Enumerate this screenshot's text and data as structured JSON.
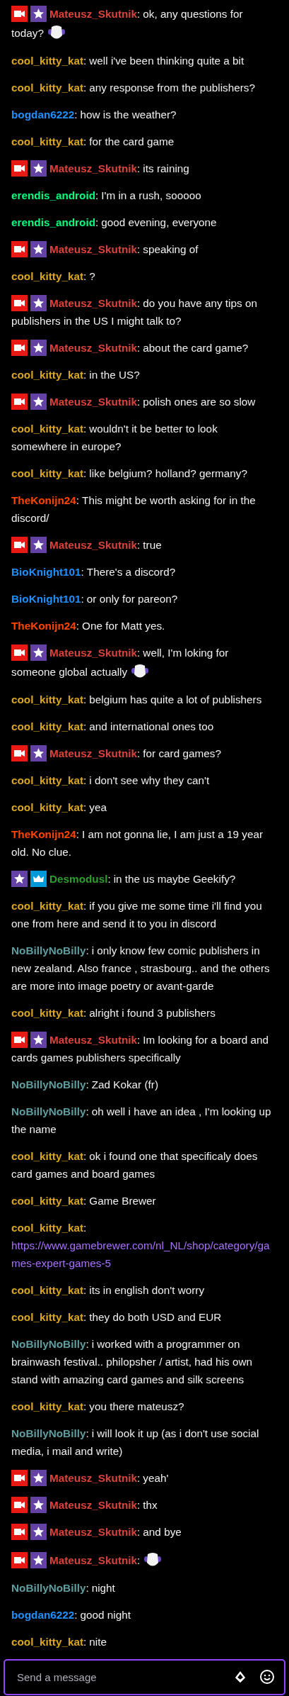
{
  "messages": [
    {
      "badges": [
        {
          "kind": "broadcaster"
        },
        {
          "kind": "subscriber"
        }
      ],
      "user": "Mateusz_Skutnik",
      "color": "#d9433c",
      "separator": ":",
      "parts": [
        {
          "kind": "text",
          "text": "ok, any questions for today?"
        },
        {
          "kind": "emote"
        }
      ]
    },
    {
      "user": "cool_kitty_kat",
      "color": "#daa520",
      "separator": ":",
      "parts": [
        {
          "kind": "text",
          "text": "well i've been thinking quite a bit"
        }
      ]
    },
    {
      "user": "cool_kitty_kat",
      "color": "#daa520",
      "separator": ":",
      "parts": [
        {
          "kind": "text",
          "text": "any response from the publishers?"
        }
      ]
    },
    {
      "user": "bogdan6222",
      "color": "#1e90ff",
      "separator": ":",
      "parts": [
        {
          "kind": "text",
          "text": "how is the weather?"
        }
      ]
    },
    {
      "user": "cool_kitty_kat",
      "color": "#daa520",
      "separator": ":",
      "parts": [
        {
          "kind": "text",
          "text": "for the card game"
        }
      ]
    },
    {
      "badges": [
        {
          "kind": "broadcaster"
        },
        {
          "kind": "subscriber"
        }
      ],
      "user": "Mateusz_Skutnik",
      "color": "#d9433c",
      "separator": ":",
      "parts": [
        {
          "kind": "text",
          "text": "its raining"
        }
      ]
    },
    {
      "user": "erendis_android",
      "color": "#00ff7f",
      "separator": ":",
      "parts": [
        {
          "kind": "text",
          "text": "I'm in a rush, sooooo"
        }
      ]
    },
    {
      "user": "erendis_android",
      "color": "#00ff7f",
      "separator": ":",
      "parts": [
        {
          "kind": "text",
          "text": "good evening, everyone"
        }
      ]
    },
    {
      "badges": [
        {
          "kind": "broadcaster"
        },
        {
          "kind": "subscriber"
        }
      ],
      "user": "Mateusz_Skutnik",
      "color": "#d9433c",
      "separator": ":",
      "parts": [
        {
          "kind": "text",
          "text": "speaking of"
        }
      ]
    },
    {
      "user": "cool_kitty_kat",
      "color": "#daa520",
      "separator": ":",
      "parts": [
        {
          "kind": "text",
          "text": "?"
        }
      ]
    },
    {
      "badges": [
        {
          "kind": "broadcaster"
        },
        {
          "kind": "subscriber"
        }
      ],
      "user": "Mateusz_Skutnik",
      "color": "#d9433c",
      "separator": ":",
      "parts": [
        {
          "kind": "text",
          "text": "do you have any tips on publishers in the US I might talk to?"
        }
      ]
    },
    {
      "badges": [
        {
          "kind": "broadcaster"
        },
        {
          "kind": "subscriber"
        }
      ],
      "user": "Mateusz_Skutnik",
      "color": "#d9433c",
      "separator": ":",
      "parts": [
        {
          "kind": "text",
          "text": "about the card game?"
        }
      ]
    },
    {
      "user": "cool_kitty_kat",
      "color": "#daa520",
      "separator": ":",
      "parts": [
        {
          "kind": "text",
          "text": "in the US?"
        }
      ]
    },
    {
      "badges": [
        {
          "kind": "broadcaster"
        },
        {
          "kind": "subscriber"
        }
      ],
      "user": "Mateusz_Skutnik",
      "color": "#d9433c",
      "separator": ":",
      "parts": [
        {
          "kind": "text",
          "text": "polish ones are so slow"
        }
      ]
    },
    {
      "user": "cool_kitty_kat",
      "color": "#daa520",
      "separator": ":",
      "parts": [
        {
          "kind": "text",
          "text": "wouldn't it be better to look somewhere in europe?"
        }
      ]
    },
    {
      "user": "cool_kitty_kat",
      "color": "#daa520",
      "separator": ":",
      "parts": [
        {
          "kind": "text",
          "text": "like belgium? holland? germany?"
        }
      ]
    },
    {
      "user": "TheKonijn24",
      "color": "#ff4500",
      "separator": ":",
      "parts": [
        {
          "kind": "text",
          "text": "This might be worth asking for in the discord/"
        }
      ]
    },
    {
      "badges": [
        {
          "kind": "broadcaster"
        },
        {
          "kind": "subscriber"
        }
      ],
      "user": "Mateusz_Skutnik",
      "color": "#d9433c",
      "separator": ":",
      "parts": [
        {
          "kind": "text",
          "text": "true"
        }
      ]
    },
    {
      "user": "BioKnight101",
      "color": "#1e90ff",
      "separator": ":",
      "parts": [
        {
          "kind": "text",
          "text": "There's a discord?"
        }
      ]
    },
    {
      "user": "BioKnight101",
      "color": "#1e90ff",
      "separator": ":",
      "parts": [
        {
          "kind": "text",
          "text": "or only for pareon?"
        }
      ]
    },
    {
      "user": "TheKonijn24",
      "color": "#ff4500",
      "separator": ":",
      "parts": [
        {
          "kind": "text",
          "text": "One for Matt yes."
        }
      ]
    },
    {
      "badges": [
        {
          "kind": "broadcaster"
        },
        {
          "kind": "subscriber"
        }
      ],
      "user": "Mateusz_Skutnik",
      "color": "#d9433c",
      "separator": ":",
      "parts": [
        {
          "kind": "text",
          "text": "well, I'm loking for someone global actually"
        },
        {
          "kind": "emote"
        }
      ]
    },
    {
      "user": "cool_kitty_kat",
      "color": "#daa520",
      "separator": ":",
      "parts": [
        {
          "kind": "text",
          "text": "belgium has quite a lot of publishers"
        }
      ]
    },
    {
      "user": "cool_kitty_kat",
      "color": "#daa520",
      "separator": ":",
      "parts": [
        {
          "kind": "text",
          "text": "and international ones too"
        }
      ]
    },
    {
      "badges": [
        {
          "kind": "broadcaster"
        },
        {
          "kind": "subscriber"
        }
      ],
      "user": "Mateusz_Skutnik",
      "color": "#d9433c",
      "separator": ":",
      "parts": [
        {
          "kind": "text",
          "text": "for card games?"
        }
      ]
    },
    {
      "user": "cool_kitty_kat",
      "color": "#daa520",
      "separator": ":",
      "parts": [
        {
          "kind": "text",
          "text": "i don't see why they can't"
        }
      ]
    },
    {
      "user": "cool_kitty_kat",
      "color": "#daa520",
      "separator": ":",
      "parts": [
        {
          "kind": "text",
          "text": "yea"
        }
      ]
    },
    {
      "user": "TheKonijn24",
      "color": "#ff4500",
      "separator": ":",
      "parts": [
        {
          "kind": "text",
          "text": "I am not gonna lie, I am just a 19 year old. No clue."
        }
      ]
    },
    {
      "badges": [
        {
          "kind": "subscriber"
        },
        {
          "kind": "prime"
        }
      ],
      "user": "Desmodusl",
      "color": "#2e9e2e",
      "separator": ":",
      "parts": [
        {
          "kind": "text",
          "text": "in the us maybe Geekify?"
        }
      ]
    },
    {
      "user": "cool_kitty_kat",
      "color": "#daa520",
      "separator": ":",
      "parts": [
        {
          "kind": "text",
          "text": "if you give me some time i'll find you one from here and send it to you in discord"
        }
      ]
    },
    {
      "user": "NoBillyNoBilly",
      "color": "#5f9ea0",
      "separator": ":",
      "parts": [
        {
          "kind": "text",
          "text": "i only know few comic publishers in new zealand. Also france , strasbourg.. and the others are more into image poetry or avant-garde"
        }
      ]
    },
    {
      "user": "cool_kitty_kat",
      "color": "#daa520",
      "separator": ":",
      "parts": [
        {
          "kind": "text",
          "text": "alright i found 3 publishers"
        }
      ]
    },
    {
      "badges": [
        {
          "kind": "broadcaster"
        },
        {
          "kind": "subscriber"
        }
      ],
      "user": "Mateusz_Skutnik",
      "color": "#d9433c",
      "separator": ":",
      "parts": [
        {
          "kind": "text",
          "text": "Im looking for a board and cards games publishers specifically"
        }
      ]
    },
    {
      "user": "NoBillyNoBilly",
      "color": "#5f9ea0",
      "separator": ":",
      "parts": [
        {
          "kind": "text",
          "text": "Zad Kokar (fr)"
        }
      ]
    },
    {
      "user": "NoBillyNoBilly",
      "color": "#5f9ea0",
      "separator": ":",
      "parts": [
        {
          "kind": "text",
          "text": "oh well i have an idea , I'm looking up the name"
        }
      ]
    },
    {
      "user": "cool_kitty_kat",
      "color": "#daa520",
      "separator": ":",
      "parts": [
        {
          "kind": "text",
          "text": "ok i found one that specificaly does card games and board games"
        }
      ]
    },
    {
      "user": "cool_kitty_kat",
      "color": "#daa520",
      "separator": ":",
      "parts": [
        {
          "kind": "text",
          "text": "Game Brewer"
        }
      ]
    },
    {
      "user": "cool_kitty_kat",
      "color": "#daa520",
      "separator": ":",
      "parts": [
        {
          "kind": "link",
          "text": "https://www.gamebrewer.com/nl_NL/shop/category/games-expert-games-5"
        }
      ]
    },
    {
      "user": "cool_kitty_kat",
      "color": "#daa520",
      "separator": ":",
      "parts": [
        {
          "kind": "text",
          "text": "its in english don't worry"
        }
      ]
    },
    {
      "user": "cool_kitty_kat",
      "color": "#daa520",
      "separator": ":",
      "parts": [
        {
          "kind": "text",
          "text": "they do both USD and EUR"
        }
      ]
    },
    {
      "user": "NoBillyNoBilly",
      "color": "#5f9ea0",
      "separator": ":",
      "parts": [
        {
          "kind": "text",
          "text": "i worked with a programmer on brainwash festival.. philopsher / artist, had his own stand with amazing card games and silk screens"
        }
      ]
    },
    {
      "user": "cool_kitty_kat",
      "color": "#daa520",
      "separator": ":",
      "parts": [
        {
          "kind": "text",
          "text": "you there mateusz?"
        }
      ]
    },
    {
      "user": "NoBillyNoBilly",
      "color": "#5f9ea0",
      "separator": ":",
      "parts": [
        {
          "kind": "text",
          "text": "i will look it up (as i don't use social media, i mail and write)"
        }
      ]
    },
    {
      "badges": [
        {
          "kind": "broadcaster"
        },
        {
          "kind": "subscriber"
        }
      ],
      "user": "Mateusz_Skutnik",
      "color": "#d9433c",
      "separator": ":",
      "parts": [
        {
          "kind": "text",
          "text": "yeah'"
        }
      ]
    },
    {
      "badges": [
        {
          "kind": "broadcaster"
        },
        {
          "kind": "subscriber"
        }
      ],
      "user": "Mateusz_Skutnik",
      "color": "#d9433c",
      "separator": ":",
      "parts": [
        {
          "kind": "text",
          "text": "thx"
        }
      ]
    },
    {
      "badges": [
        {
          "kind": "broadcaster"
        },
        {
          "kind": "subscriber"
        }
      ],
      "user": "Mateusz_Skutnik",
      "color": "#d9433c",
      "separator": ":",
      "parts": [
        {
          "kind": "text",
          "text": "and bye"
        }
      ]
    },
    {
      "badges": [
        {
          "kind": "broadcaster"
        },
        {
          "kind": "subscriber"
        }
      ],
      "user": "Mateusz_Skutnik",
      "color": "#d9433c",
      "separator": ":",
      "parts": [
        {
          "kind": "emote"
        }
      ]
    },
    {
      "user": "NoBillyNoBilly",
      "color": "#5f9ea0",
      "separator": ":",
      "parts": [
        {
          "kind": "text",
          "text": "night"
        }
      ]
    },
    {
      "user": "bogdan6222",
      "color": "#1e90ff",
      "separator": ":",
      "parts": [
        {
          "kind": "text",
          "text": "good night"
        }
      ]
    },
    {
      "user": "cool_kitty_kat",
      "color": "#daa520",
      "separator": ":",
      "parts": [
        {
          "kind": "text",
          "text": "nite"
        }
      ]
    }
  ],
  "composer": {
    "placeholder": "Send a message"
  }
}
